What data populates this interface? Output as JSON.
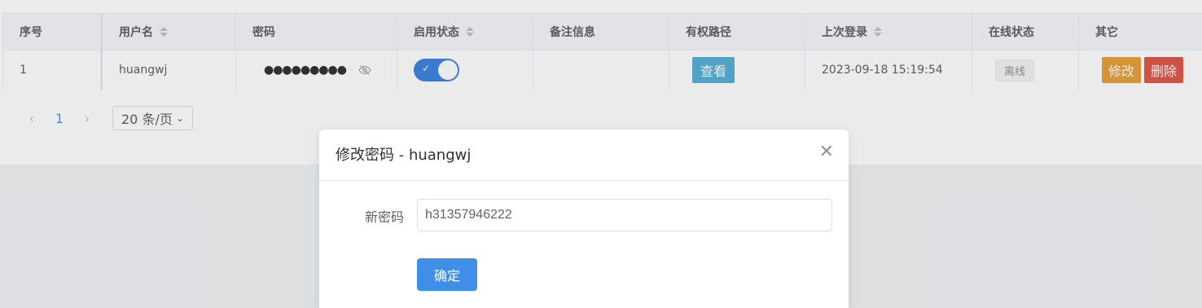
{
  "table": {
    "headers": [
      "序号",
      "用户名",
      "密码",
      "启用状态",
      "备注信息",
      "有权路径",
      "上次登录",
      "在线状态",
      "其它"
    ],
    "row": {
      "index": "1",
      "username": "huangwj",
      "password_mask": "●●●●●●●●●",
      "enabled": true,
      "remark": "",
      "path_button": "查看",
      "last_login": "2023-09-18 15:19:54",
      "online_status": "离线",
      "edit_button": "修改",
      "delete_button": "删除"
    }
  },
  "pagination": {
    "current_page": "1",
    "page_size_label": "20 条/页"
  },
  "dialog": {
    "title": "修改密码 - huangwj",
    "field_label": "新密码",
    "field_value": "h31357946222",
    "confirm_button": "确定"
  },
  "colors": {
    "primary": "#3f8ee8",
    "view": "#5ab0d6",
    "edit": "#e6a23c",
    "delete": "#e0594a"
  },
  "icons": {
    "sort": "sort-caret-icon",
    "eye": "eye-off-icon",
    "close": "close-icon"
  }
}
